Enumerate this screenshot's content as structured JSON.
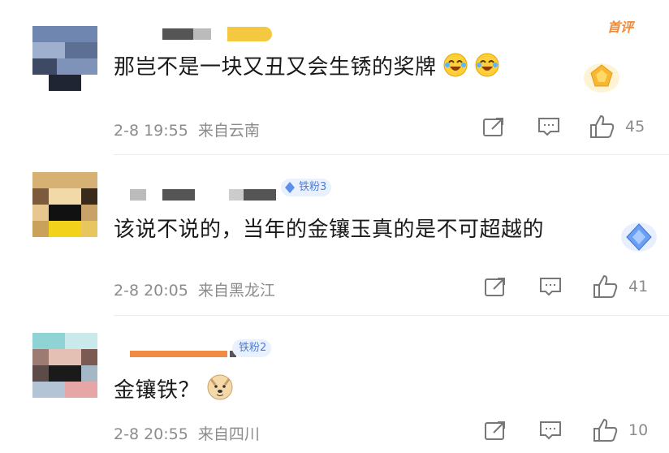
{
  "first_tag": "首评",
  "comments": [
    {
      "text": "那岂不是一块又丑又会生锈的奖牌",
      "date": "2-8 19:55",
      "location": "来自云南",
      "likes": "45"
    },
    {
      "fan_badge": "铁粉3",
      "text": "该说不说的，当年的金镶玉真的是不可超越的",
      "date": "2-8 20:05",
      "location": "来自黑龙江",
      "likes": "41"
    },
    {
      "fan_badge": "铁粉2",
      "text": "金镶铁？",
      "date": "2-8 20:55",
      "location": "来自四川",
      "likes": "10"
    }
  ],
  "icons": {
    "share": "share-icon",
    "comment": "comment-icon",
    "like": "thumbs-up-icon",
    "laugh_cry": "laughing-crying-emoji",
    "doge": "doge-emoji",
    "medal_gold": "gold-medal-icon",
    "medal_blue": "diamond-medal-icon"
  },
  "colors": {
    "text": "#1a1a1a",
    "meta": "#8c8c8c",
    "badge_bg": "#e9f1ff",
    "badge_fg": "#4f7ed8",
    "first_tag": "#f08a3a"
  }
}
